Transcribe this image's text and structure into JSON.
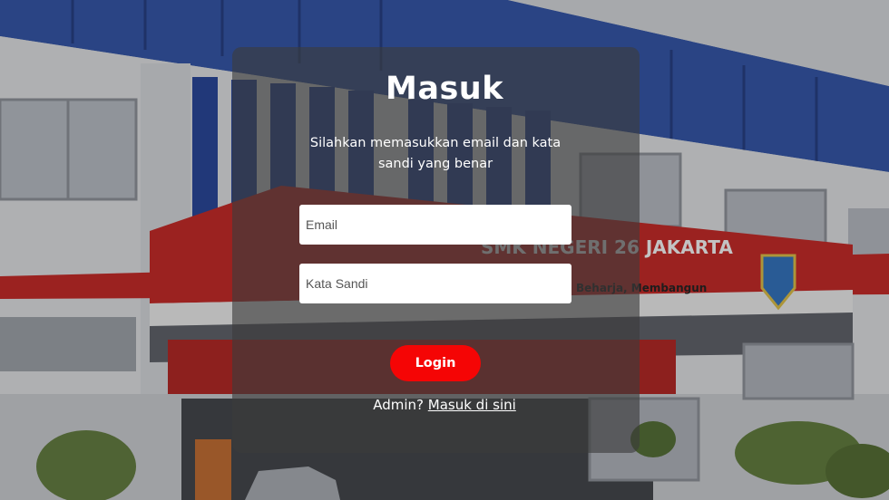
{
  "login": {
    "title": "Masuk",
    "subtitle": "Silahkan memasukkan email dan kata sandi yang benar",
    "email_placeholder": "Email",
    "password_placeholder": "Kata Sandi",
    "login_label": "Login",
    "admin_prefix": "Admin?",
    "admin_link": "Masuk di sini"
  },
  "background": {
    "school_sign": "SMK NEGERI 26 JAKARTA",
    "motto": "Beharja, Membangun"
  },
  "colors": {
    "accent": "#f50505",
    "building_blue": "#2b4fa8",
    "building_red": "#c8201e"
  }
}
